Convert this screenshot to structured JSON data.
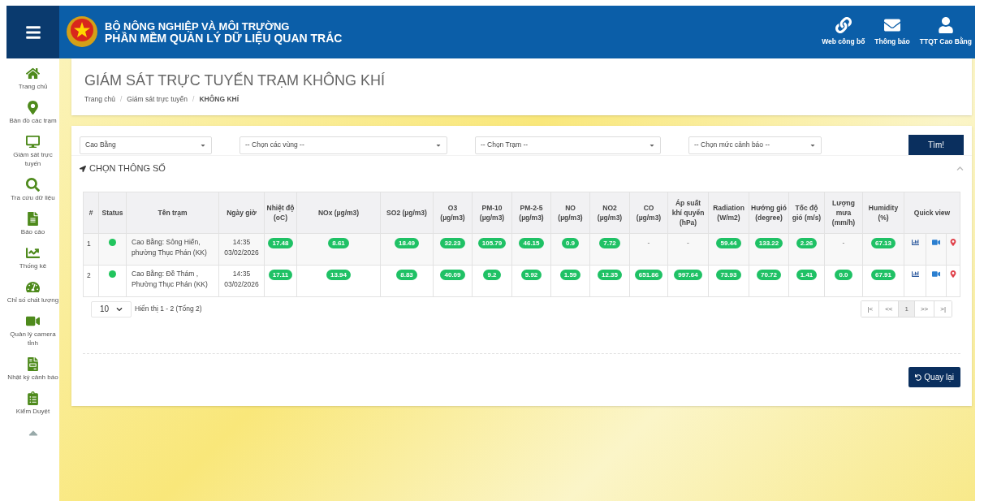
{
  "header": {
    "ministry": "BỘ NÔNG NGHIỆP VÀ MÔI TRƯỜNG",
    "app_title": "PHẦN MỀM QUẢN LÝ DỮ LIỆU QUAN TRẮC",
    "actions": [
      {
        "label": "Web công bố"
      },
      {
        "label": "Thông báo"
      },
      {
        "label": "TTQT Cao Bằng"
      }
    ]
  },
  "sidebar": {
    "items": [
      {
        "label": "Trang chủ"
      },
      {
        "label": "Bản đồ các trạm"
      },
      {
        "label": "Giám sát trực tuyến"
      },
      {
        "label": "Tra cứu dữ liệu"
      },
      {
        "label": "Báo cáo"
      },
      {
        "label": "Thống kê"
      },
      {
        "label": "Chỉ số chất lượng"
      },
      {
        "label": "Quản lý camera tỉnh"
      },
      {
        "label": "Nhật ký cảnh báo"
      },
      {
        "label": "Kiểm Duyệt"
      }
    ]
  },
  "page": {
    "title": "GIÁM SÁT TRỰC TUYẾN TRẠM KHÔNG KHÍ",
    "breadcrumb": [
      "Trang chủ",
      "Giám sát trực tuyến",
      "KHÔNG KHÍ"
    ],
    "breadcrumb_separator": "/"
  },
  "filters": {
    "selects": [
      {
        "value": "Cao Bằng"
      },
      {
        "value": "-- Chọn các vùng --"
      },
      {
        "value": "-- Chọn Trạm --"
      },
      {
        "value": "-- Chọn mức cảnh báo --"
      }
    ],
    "search_button": "Tìm!"
  },
  "section": {
    "title": "CHỌN THÔNG SỐ",
    "expanded": true
  },
  "table": {
    "columns": [
      "#",
      "Status",
      "Tên trạm",
      "Ngày giờ",
      "Nhiệt độ (oC)",
      "NOx (µg/m3)",
      "SO2 (µg/m3)",
      "O3 (µg/m3)",
      "PM-10 (µg/m3)",
      "PM-2-5 (µg/m3)",
      "NO (µg/m3)",
      "NO2 (µg/m3)",
      "CO (µg/m3)",
      "Áp suất khí quyển (hPa)",
      "Radiation (W/m2)",
      "Hướng gió (degree)",
      "Tốc độ gió (m/s)",
      "Lượng mưa (mm/h)",
      "Humidity (%)",
      "Quick view"
    ],
    "rows": [
      {
        "index": "1",
        "color": "#22c55e",
        "station": "Cao Bằng: Sông Hiến, phường Thục Phán (KK)",
        "time": "14:35",
        "date": "03/02/2026",
        "readings": [
          {
            "value": "17.48",
            "kind": "badge"
          },
          {
            "value": "8.61",
            "kind": "badge"
          },
          {
            "value": "18.49",
            "kind": "badge"
          },
          {
            "value": "32.23",
            "kind": "badge"
          },
          {
            "value": "105.79",
            "kind": "badge"
          },
          {
            "value": "46.15",
            "kind": "badge"
          },
          {
            "value": "0.9",
            "kind": "badge"
          },
          {
            "value": "7.72",
            "kind": "badge"
          },
          {
            "value": "-",
            "kind": "plain"
          },
          {
            "value": "-",
            "kind": "plain"
          },
          {
            "value": "59.44",
            "kind": "badge"
          },
          {
            "value": "133.22",
            "kind": "badge"
          },
          {
            "value": "2.26",
            "kind": "badge"
          },
          {
            "value": "-",
            "kind": "plain"
          },
          {
            "value": "67.13",
            "kind": "badge"
          }
        ]
      },
      {
        "index": "2",
        "color": "#22c55e",
        "station": "Cao Bằng: Đề Thám , Phường Thục Phán (KK)",
        "time": "14:35",
        "date": "03/02/2026",
        "readings": [
          {
            "value": "17.11",
            "kind": "badge"
          },
          {
            "value": "13.94",
            "kind": "badge"
          },
          {
            "value": "8.83",
            "kind": "badge"
          },
          {
            "value": "40.09",
            "kind": "badge"
          },
          {
            "value": "9.2",
            "kind": "badge"
          },
          {
            "value": "5.92",
            "kind": "badge"
          },
          {
            "value": "1.59",
            "kind": "badge"
          },
          {
            "value": "12.35",
            "kind": "badge"
          },
          {
            "value": "651.86",
            "kind": "badge"
          },
          {
            "value": "997.64",
            "kind": "badge"
          },
          {
            "value": "73.93",
            "kind": "badge"
          },
          {
            "value": "70.72",
            "kind": "badge"
          },
          {
            "value": "1.41",
            "kind": "badge"
          },
          {
            "value": "0.0",
            "kind": "badge"
          },
          {
            "value": "67.91",
            "kind": "badge"
          }
        ]
      }
    ]
  },
  "pagination": {
    "page_size": "10",
    "summary": "Hiển thị 1 - 2 (Tổng 2)",
    "pages": [
      {
        "label": "|<",
        "selected": false
      },
      {
        "label": "<<",
        "selected": false
      },
      {
        "label": "1",
        "selected": true
      },
      {
        "label": ">>",
        "selected": false
      },
      {
        "label": ">|",
        "selected": false
      }
    ]
  },
  "back_button": "Quay lại"
}
